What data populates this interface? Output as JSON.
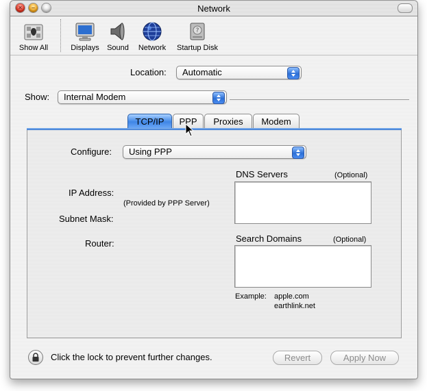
{
  "window": {
    "title": "Network"
  },
  "toolbar": {
    "items": [
      {
        "label": "Show All",
        "icon": "apple-showall-icon"
      },
      {
        "label": "Displays",
        "icon": "display-monitor-icon"
      },
      {
        "label": "Sound",
        "icon": "speaker-icon"
      },
      {
        "label": "Network",
        "icon": "globe-icon"
      },
      {
        "label": "Startup Disk",
        "icon": "hard-disk-icon"
      }
    ]
  },
  "location": {
    "label": "Location:",
    "value": "Automatic"
  },
  "show": {
    "label": "Show:",
    "value": "Internal Modem"
  },
  "tabs": [
    {
      "label": "TCP/IP",
      "active": true
    },
    {
      "label": "PPP",
      "active": false
    },
    {
      "label": "Proxies",
      "active": false
    },
    {
      "label": "Modem",
      "active": false
    }
  ],
  "tcpip": {
    "configure_label": "Configure:",
    "configure_value": "Using PPP",
    "ip_address_label": "IP Address:",
    "ip_address_note": "(Provided by PPP Server)",
    "subnet_mask_label": "Subnet Mask:",
    "router_label": "Router:",
    "dns_servers_label": "DNS Servers",
    "dns_optional": "(Optional)",
    "search_domains_label": "Search Domains",
    "search_optional": "(Optional)",
    "example_label": "Example:",
    "example_line1": "apple.com",
    "example_line2": "earthlink.net"
  },
  "footer": {
    "lock_text": "Click the lock to prevent further changes.",
    "revert_label": "Revert",
    "apply_label": "Apply Now"
  },
  "colors": {
    "accent": "#3f86e6",
    "disabled_text": "#8c8c8c"
  }
}
